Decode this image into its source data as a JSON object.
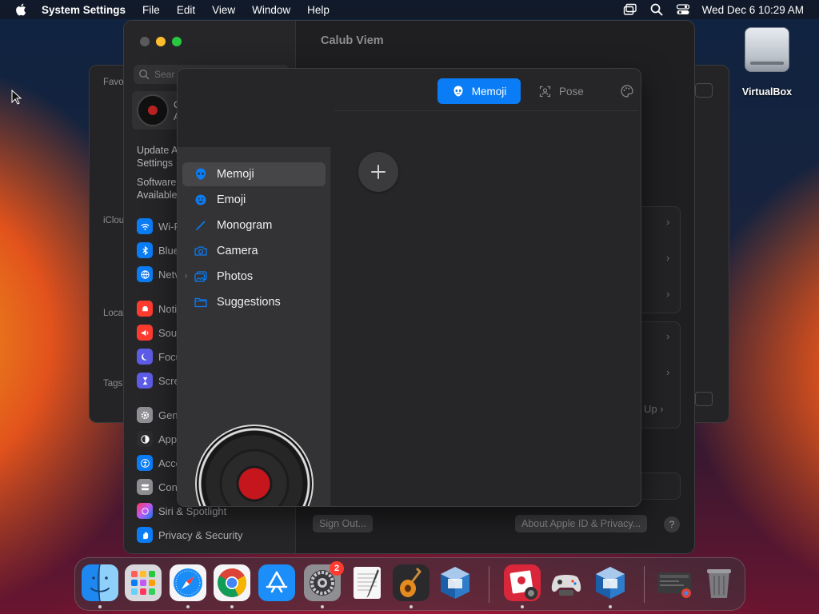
{
  "menubar": {
    "app_name": "System Settings",
    "menus": [
      "File",
      "Edit",
      "View",
      "Window",
      "Help"
    ],
    "clock": "Wed Dec 6  10:29 AM"
  },
  "desktop": {
    "icon_label": "VirtualBox"
  },
  "back_window": {
    "labels": [
      "Favo",
      "iClou",
      "Loca",
      "Tags"
    ]
  },
  "settings": {
    "title": "Calub Viem",
    "search_placeholder": "Sear",
    "profile_line1": "C",
    "profile_line2": "A",
    "update_text_1": "Update A",
    "update_text_2": "Settings",
    "software_text_1": "Software",
    "software_text_2": "Available",
    "sidebar_items": [
      {
        "label": "Wi-F",
        "color": "#0a7cf5"
      },
      {
        "label": "Blue",
        "color": "#0a7cf5"
      },
      {
        "label": "Netv",
        "color": "#0a7cf5"
      },
      {
        "label": "Notif",
        "color": "#ff3b30"
      },
      {
        "label": "Sou",
        "color": "#ff3b30"
      },
      {
        "label": "Focu",
        "color": "#5e5ce6"
      },
      {
        "label": "Scre",
        "color": "#5e5ce6"
      },
      {
        "label": "Gen",
        "color": "#8e8e93"
      },
      {
        "label": "App",
        "color": "#2c2c2e"
      },
      {
        "label": "Acce",
        "color": "#0a7cf5"
      },
      {
        "label": "Con",
        "color": "#8e8e93"
      },
      {
        "label": "Siri & Spotlight",
        "color": "#bf5af2"
      },
      {
        "label": "Privacy & Security",
        "color": "#0a7cf5"
      }
    ],
    "sign_out": "Sign Out...",
    "about_apple_id": "About Apple ID & Privacy...",
    "help": "?",
    "setup_text": "Up"
  },
  "picker": {
    "tab_memoji": "Memoji",
    "tab_pose": "Pose",
    "categories": [
      {
        "label": "Memoji",
        "icon": "memoji-icon"
      },
      {
        "label": "Emoji",
        "icon": "emoji-icon"
      },
      {
        "label": "Monogram",
        "icon": "pencil-icon"
      },
      {
        "label": "Camera",
        "icon": "camera-icon"
      },
      {
        "label": "Photos",
        "icon": "photos-icon"
      },
      {
        "label": "Suggestions",
        "icon": "folder-icon"
      }
    ],
    "selected_category": "Memoji"
  },
  "dock": {
    "apps": [
      "Finder",
      "Launchpad",
      "Safari",
      "Chrome",
      "App Store",
      "System Settings",
      "TextEdit",
      "GarageBand",
      "VirtualBox",
      "Photo Booth",
      "Game Controller",
      "VirtualBox",
      "Downloads",
      "Trash"
    ],
    "settings_badge": "2"
  },
  "colors": {
    "accent": "#0a7cf5",
    "badge": "#ff3b30"
  }
}
